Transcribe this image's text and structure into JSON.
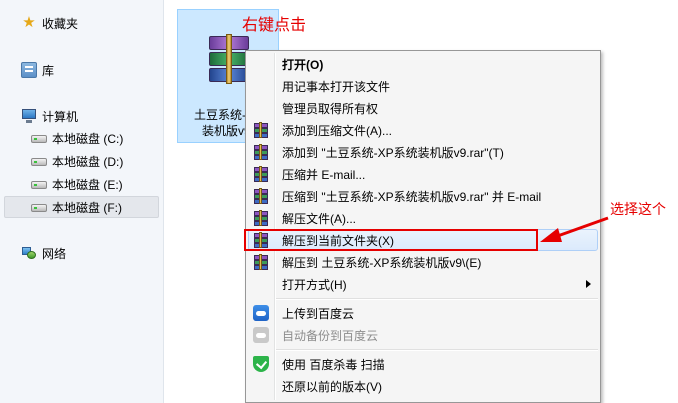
{
  "nav": {
    "favorites": "收藏夹",
    "libraries": "库",
    "computer": "计算机",
    "drives": [
      {
        "label": "本地磁盘 (C:)"
      },
      {
        "label": "本地磁盘 (D:)"
      },
      {
        "label": "本地磁盘 (E:)"
      },
      {
        "label": "本地磁盘 (F:)"
      }
    ],
    "network": "网络"
  },
  "file": {
    "name_line1": "土豆系统-XP",
    "name_line2": "装机版v9."
  },
  "annotations": {
    "right_click": "右键点击",
    "choose_this": "选择这个",
    "color": "#e60000"
  },
  "menu": {
    "items": [
      {
        "label": "打开(O)"
      },
      {
        "label": "用记事本打开该文件"
      },
      {
        "label": "管理员取得所有权"
      },
      {
        "label": "添加到压缩文件(A)..."
      },
      {
        "label": "添加到 \"土豆系统-XP系统装机版v9.rar\"(T)"
      },
      {
        "label": "压缩并 E-mail..."
      },
      {
        "label": "压缩到 \"土豆系统-XP系统装机版v9.rar\" 并 E-mail"
      },
      {
        "label": "解压文件(A)..."
      },
      {
        "label": "解压到当前文件夹(X)"
      },
      {
        "label": "解压到 土豆系统-XP系统装机版v9\\(E)"
      },
      {
        "label": "打开方式(H)"
      },
      {
        "label": "上传到百度云"
      },
      {
        "label": "自动备份到百度云"
      },
      {
        "label": "使用 百度杀毒 扫描"
      },
      {
        "label": "还原以前的版本(V)"
      }
    ]
  }
}
